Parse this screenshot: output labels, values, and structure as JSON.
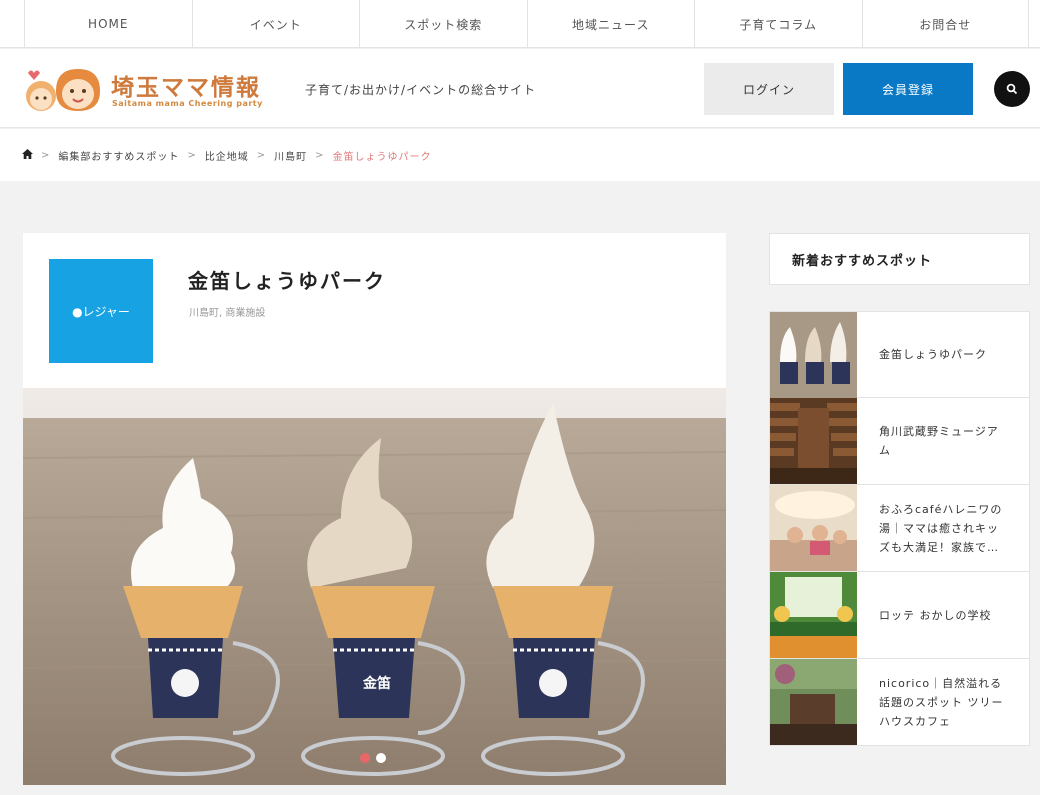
{
  "nav": {
    "items": [
      "HOME",
      "イベント",
      "スポット検索",
      "地域ニュース",
      "子育てコラム",
      "お問合せ"
    ]
  },
  "header": {
    "logo_title": "埼玉ママ情報",
    "logo_subtitle": "Saitama mama Cheering party",
    "tagline": "子育て/お出かけ/イベントの総合サイト",
    "login_label": "ログイン",
    "register_label": "会員登録",
    "search_icon": "search-icon"
  },
  "breadcrumb": {
    "home_icon": "home-icon",
    "items": [
      "編集部おすすめスポット",
      "比企地域",
      "川島町"
    ],
    "current": "金笛しょうゆパーク"
  },
  "spot": {
    "category": "●レジャー",
    "title": "金笛しょうゆパーク",
    "tags": "川島町, 商業施設",
    "slider_count": 2,
    "slider_active": 1
  },
  "sidebar": {
    "heading": "新着おすすめスポット",
    "items": [
      {
        "title": "金笛しょうゆパーク"
      },
      {
        "title": "角川武蔵野ミュージアム"
      },
      {
        "title": "おふろcaféハレニワの湯｜ママは癒されキッズも大満足！家族で…"
      },
      {
        "title": "ロッテ おかしの学校"
      },
      {
        "title": "nicorico｜自然溢れる話題のスポット ツリーハウスカフェ"
      }
    ]
  },
  "colors": {
    "accent_blue": "#0a79c5",
    "category_blue": "#17a3e3",
    "breadcrumb_current": "#e07a7a",
    "logo_orange": "#cf7a3d"
  }
}
